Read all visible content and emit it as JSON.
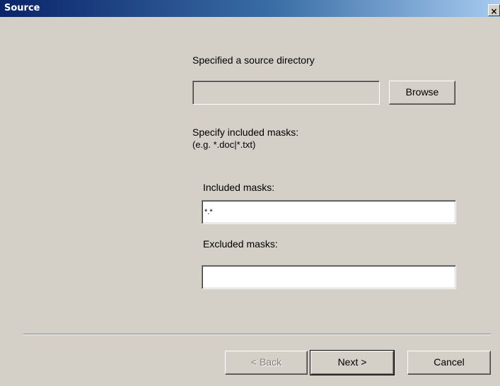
{
  "window": {
    "title": "Source",
    "close_label": "×"
  },
  "source": {
    "heading": "Specified a source directory",
    "directory_value": "",
    "browse_label": "Browse"
  },
  "masks": {
    "instruction_line1": "Specify included masks:",
    "instruction_line2": "(e.g. *.doc|*.txt)",
    "included_label": "Included masks:",
    "included_value": "*.*",
    "excluded_label": "Excluded masks:",
    "excluded_value": ""
  },
  "footer": {
    "back_label": "< Back",
    "next_label": "Next >",
    "cancel_label": "Cancel"
  },
  "colors": {
    "dialog_background": "#d4d0c8",
    "title_gradient_start": "#0a246a",
    "title_gradient_end": "#a6caf0"
  }
}
